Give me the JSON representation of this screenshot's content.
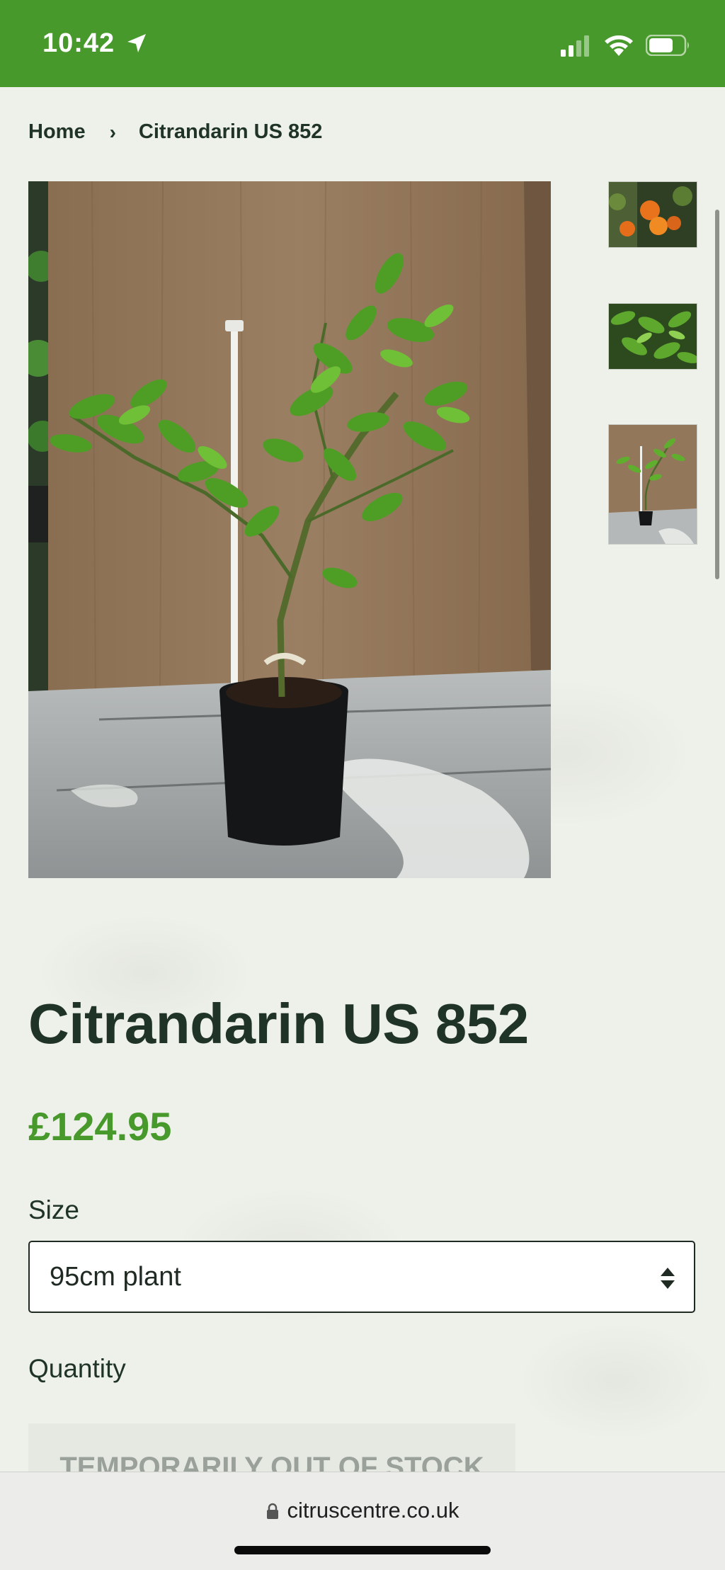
{
  "status_bar": {
    "time": "10:42",
    "icons": [
      "location-arrow-icon",
      "cellular-signal-icon",
      "wifi-icon",
      "battery-icon"
    ]
  },
  "breadcrumb": {
    "home": "Home",
    "separator": "›",
    "current": "Citrandarin US 852"
  },
  "product": {
    "title": "Citrandarin US 852",
    "price": "£124.95",
    "size_label": "Size",
    "size_selected": "95cm plant",
    "quantity_label": "Quantity",
    "stock_button": "TEMPORARILY OUT OF STOCK"
  },
  "browser": {
    "url": "citruscentre.co.uk"
  },
  "colors": {
    "brand_green": "#46992a",
    "text_dark": "#1f3326",
    "background": "#eef0ea"
  }
}
